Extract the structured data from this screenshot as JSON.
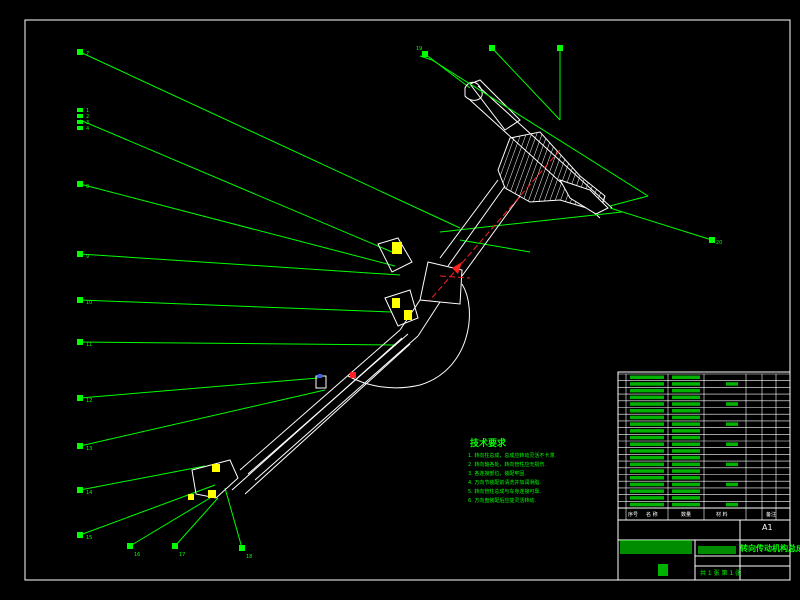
{
  "drawing": {
    "line_color": "#00ff00",
    "outline_color": "#ffffff",
    "section_color": "#ff2020",
    "background": "#000000"
  },
  "balloons": [
    "7",
    "8",
    "9",
    "10",
    "11",
    "12",
    "13",
    "14",
    "15",
    "16",
    "17",
    "18",
    "19",
    "20",
    "1",
    "2",
    "3",
    "4"
  ],
  "tech_notes": {
    "title": "技术要求",
    "lines": [
      "1. 转向柱总成，总成应转动灵活不卡滞.",
      "2. 转向轴各处，转向管柱应无损伤.",
      "3. 各连接部位，装配牢固.",
      "4. 万向节装配前清洗并加润滑脂.",
      "5. 转向管柱总成与车身连接可靠.",
      "6. 方向盘装配后应能灵活转动."
    ]
  },
  "title_block": {
    "scale_label": "A1",
    "drawing_title": "转向传动机构总成",
    "sheet_info": "共 1 张 第 1 张",
    "header_cols": [
      "序号",
      "名 称",
      "数量",
      "材 料",
      "备注"
    ]
  }
}
